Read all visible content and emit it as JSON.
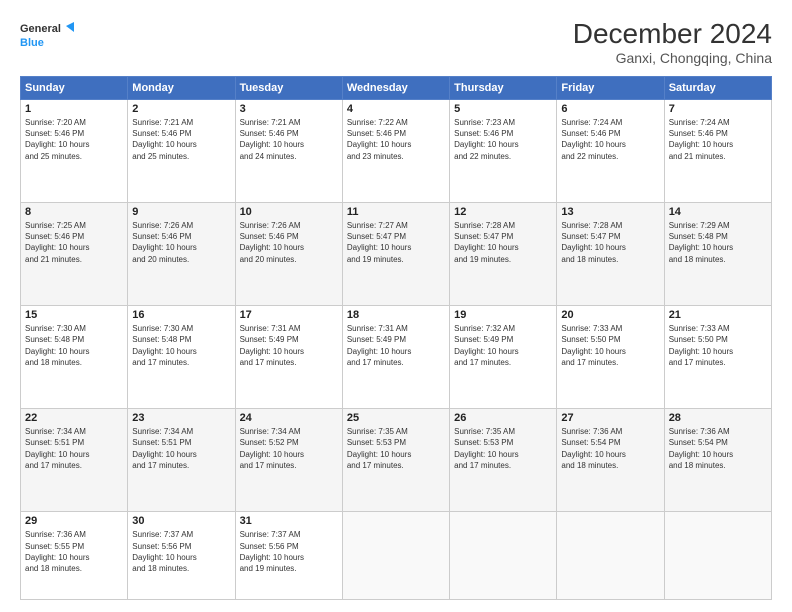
{
  "header": {
    "logo_line1": "General",
    "logo_line2": "Blue",
    "main_title": "December 2024",
    "subtitle": "Ganxi, Chongqing, China"
  },
  "days_of_week": [
    "Sunday",
    "Monday",
    "Tuesday",
    "Wednesday",
    "Thursday",
    "Friday",
    "Saturday"
  ],
  "weeks": [
    [
      {
        "day": "1",
        "info": "Sunrise: 7:20 AM\nSunset: 5:46 PM\nDaylight: 10 hours\nand 25 minutes."
      },
      {
        "day": "2",
        "info": "Sunrise: 7:21 AM\nSunset: 5:46 PM\nDaylight: 10 hours\nand 25 minutes."
      },
      {
        "day": "3",
        "info": "Sunrise: 7:21 AM\nSunset: 5:46 PM\nDaylight: 10 hours\nand 24 minutes."
      },
      {
        "day": "4",
        "info": "Sunrise: 7:22 AM\nSunset: 5:46 PM\nDaylight: 10 hours\nand 23 minutes."
      },
      {
        "day": "5",
        "info": "Sunrise: 7:23 AM\nSunset: 5:46 PM\nDaylight: 10 hours\nand 22 minutes."
      },
      {
        "day": "6",
        "info": "Sunrise: 7:24 AM\nSunset: 5:46 PM\nDaylight: 10 hours\nand 22 minutes."
      },
      {
        "day": "7",
        "info": "Sunrise: 7:24 AM\nSunset: 5:46 PM\nDaylight: 10 hours\nand 21 minutes."
      }
    ],
    [
      {
        "day": "8",
        "info": "Sunrise: 7:25 AM\nSunset: 5:46 PM\nDaylight: 10 hours\nand 21 minutes."
      },
      {
        "day": "9",
        "info": "Sunrise: 7:26 AM\nSunset: 5:46 PM\nDaylight: 10 hours\nand 20 minutes."
      },
      {
        "day": "10",
        "info": "Sunrise: 7:26 AM\nSunset: 5:46 PM\nDaylight: 10 hours\nand 20 minutes."
      },
      {
        "day": "11",
        "info": "Sunrise: 7:27 AM\nSunset: 5:47 PM\nDaylight: 10 hours\nand 19 minutes."
      },
      {
        "day": "12",
        "info": "Sunrise: 7:28 AM\nSunset: 5:47 PM\nDaylight: 10 hours\nand 19 minutes."
      },
      {
        "day": "13",
        "info": "Sunrise: 7:28 AM\nSunset: 5:47 PM\nDaylight: 10 hours\nand 18 minutes."
      },
      {
        "day": "14",
        "info": "Sunrise: 7:29 AM\nSunset: 5:48 PM\nDaylight: 10 hours\nand 18 minutes."
      }
    ],
    [
      {
        "day": "15",
        "info": "Sunrise: 7:30 AM\nSunset: 5:48 PM\nDaylight: 10 hours\nand 18 minutes."
      },
      {
        "day": "16",
        "info": "Sunrise: 7:30 AM\nSunset: 5:48 PM\nDaylight: 10 hours\nand 17 minutes."
      },
      {
        "day": "17",
        "info": "Sunrise: 7:31 AM\nSunset: 5:49 PM\nDaylight: 10 hours\nand 17 minutes."
      },
      {
        "day": "18",
        "info": "Sunrise: 7:31 AM\nSunset: 5:49 PM\nDaylight: 10 hours\nand 17 minutes."
      },
      {
        "day": "19",
        "info": "Sunrise: 7:32 AM\nSunset: 5:49 PM\nDaylight: 10 hours\nand 17 minutes."
      },
      {
        "day": "20",
        "info": "Sunrise: 7:33 AM\nSunset: 5:50 PM\nDaylight: 10 hours\nand 17 minutes."
      },
      {
        "day": "21",
        "info": "Sunrise: 7:33 AM\nSunset: 5:50 PM\nDaylight: 10 hours\nand 17 minutes."
      }
    ],
    [
      {
        "day": "22",
        "info": "Sunrise: 7:34 AM\nSunset: 5:51 PM\nDaylight: 10 hours\nand 17 minutes."
      },
      {
        "day": "23",
        "info": "Sunrise: 7:34 AM\nSunset: 5:51 PM\nDaylight: 10 hours\nand 17 minutes."
      },
      {
        "day": "24",
        "info": "Sunrise: 7:34 AM\nSunset: 5:52 PM\nDaylight: 10 hours\nand 17 minutes."
      },
      {
        "day": "25",
        "info": "Sunrise: 7:35 AM\nSunset: 5:53 PM\nDaylight: 10 hours\nand 17 minutes."
      },
      {
        "day": "26",
        "info": "Sunrise: 7:35 AM\nSunset: 5:53 PM\nDaylight: 10 hours\nand 17 minutes."
      },
      {
        "day": "27",
        "info": "Sunrise: 7:36 AM\nSunset: 5:54 PM\nDaylight: 10 hours\nand 18 minutes."
      },
      {
        "day": "28",
        "info": "Sunrise: 7:36 AM\nSunset: 5:54 PM\nDaylight: 10 hours\nand 18 minutes."
      }
    ],
    [
      {
        "day": "29",
        "info": "Sunrise: 7:36 AM\nSunset: 5:55 PM\nDaylight: 10 hours\nand 18 minutes."
      },
      {
        "day": "30",
        "info": "Sunrise: 7:37 AM\nSunset: 5:56 PM\nDaylight: 10 hours\nand 18 minutes."
      },
      {
        "day": "31",
        "info": "Sunrise: 7:37 AM\nSunset: 5:56 PM\nDaylight: 10 hours\nand 19 minutes."
      },
      {
        "day": "",
        "info": ""
      },
      {
        "day": "",
        "info": ""
      },
      {
        "day": "",
        "info": ""
      },
      {
        "day": "",
        "info": ""
      }
    ]
  ]
}
